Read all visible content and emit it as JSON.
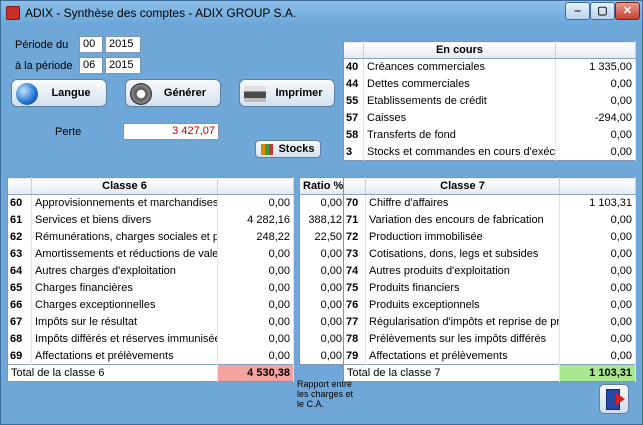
{
  "window": {
    "title": "ADIX - Synthèse des comptes - ADIX GROUP S.A.",
    "controls": {
      "minimize": "‒",
      "maximize": "▢",
      "close": "✕"
    }
  },
  "period": {
    "from_label": "Période du",
    "from_month": "00",
    "from_year": "2015",
    "to_label": "à la période",
    "to_month": "06",
    "to_year": "2015"
  },
  "buttons": {
    "langue": "Langue",
    "generer": "Générer",
    "imprimer": "Imprimer",
    "stocks": "Stocks"
  },
  "perte": {
    "label": "Perte",
    "value": "3 427,07"
  },
  "en_cours": {
    "header": "En cours",
    "rows": [
      {
        "code": "40",
        "label": "Créances commerciales",
        "value": "1 335,00"
      },
      {
        "code": "44",
        "label": "Dettes commerciales",
        "value": "0,00"
      },
      {
        "code": "55",
        "label": "Etablissements de crédit",
        "value": "0,00"
      },
      {
        "code": "57",
        "label": "Caisses",
        "value": "-294,00"
      },
      {
        "code": "58",
        "label": "Transferts de fond",
        "value": "0,00"
      },
      {
        "code": "3",
        "label": "Stocks et commandes en cours d'exécut",
        "value": "0,00"
      }
    ]
  },
  "classe6": {
    "header": "Classe 6",
    "ratio_header": "Ratio %",
    "rows": [
      {
        "code": "60",
        "label": "Approvisionnements et marchandises",
        "value": "0,00",
        "ratio": "0,00"
      },
      {
        "code": "61",
        "label": "Services et biens divers",
        "value": "4 282,16",
        "ratio": "388,12"
      },
      {
        "code": "62",
        "label": "Rémunérations, charges sociales et pen",
        "value": "248,22",
        "ratio": "22,50"
      },
      {
        "code": "63",
        "label": "Amortissements et réductions de valeur",
        "value": "0,00",
        "ratio": "0,00"
      },
      {
        "code": "64",
        "label": "Autres charges d'exploitation",
        "value": "0,00",
        "ratio": "0,00"
      },
      {
        "code": "65",
        "label": "Charges financières",
        "value": "0,00",
        "ratio": "0,00"
      },
      {
        "code": "66",
        "label": "Charges exceptionnelles",
        "value": "0,00",
        "ratio": "0,00"
      },
      {
        "code": "67",
        "label": "Impôts sur le résultat",
        "value": "0,00",
        "ratio": "0,00"
      },
      {
        "code": "68",
        "label": "Impôts différés et réserves immunisées",
        "value": "0,00",
        "ratio": "0,00"
      },
      {
        "code": "69",
        "label": "Affectations et prélèvements",
        "value": "0,00",
        "ratio": "0,00"
      }
    ],
    "total_label": "Total de la classe 6",
    "total_value": "4 530,38"
  },
  "classe7": {
    "header": "Classe 7",
    "rows": [
      {
        "code": "70",
        "label": "Chiffre d'affaires",
        "value": "1 103,31"
      },
      {
        "code": "71",
        "label": "Variation des encours de fabrication",
        "value": "0,00"
      },
      {
        "code": "72",
        "label": "Production immobilisée",
        "value": "0,00"
      },
      {
        "code": "73",
        "label": "Cotisations, dons, legs et subsides",
        "value": "0,00"
      },
      {
        "code": "74",
        "label": "Autres produits d'exploitation",
        "value": "0,00"
      },
      {
        "code": "75",
        "label": "Produits financiers",
        "value": "0,00"
      },
      {
        "code": "76",
        "label": "Produits exceptionnels",
        "value": "0,00"
      },
      {
        "code": "77",
        "label": "Régularisation d'impôts et reprise de pr",
        "value": "0,00"
      },
      {
        "code": "78",
        "label": "Prélèvements sur les impôts différés",
        "value": "0,00"
      },
      {
        "code": "79",
        "label": "Affectations et prélèvements",
        "value": "0,00"
      }
    ],
    "total_label": "Total de la classe 7",
    "total_value": "1 103,31"
  },
  "ratio_note": "Rapport entre les charges et le C.A.",
  "colors": {
    "window_background": "#6fa8d8",
    "loss_value": "#c00000",
    "total_class6": "#f4a4a0",
    "total_class7": "#a9e88e"
  },
  "icons": {
    "app": "app-icon",
    "langue": "globe-icon",
    "generer": "gear-icon",
    "imprimer": "printer-icon",
    "stocks": "stocks-icon",
    "exit": "exit-door-icon"
  }
}
